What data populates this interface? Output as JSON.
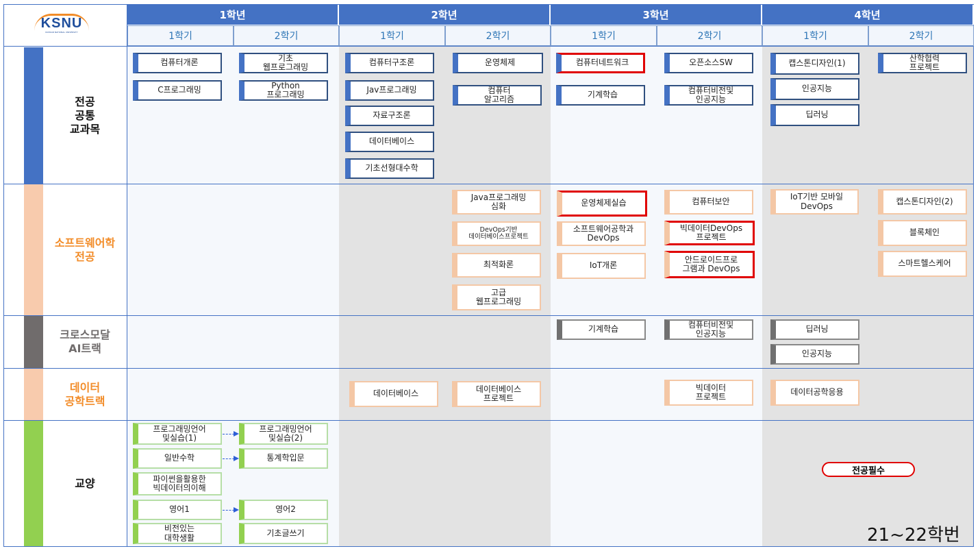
{
  "logo": {
    "text": "KSNU",
    "subtext": "KUNSAN NATIONAL UNIVERSITY"
  },
  "years": [
    "1학년",
    "2학년",
    "3학년",
    "4학년"
  ],
  "semesters": [
    "1학기",
    "2학기",
    "1학기",
    "2학기",
    "1학기",
    "2학기",
    "1학기",
    "2학기"
  ],
  "categories": {
    "major_common": "전공\n공통\n교과목",
    "software": "소프트웨어학\n전공",
    "crossmodal": "크로스모달\nAI트랙",
    "data": "데이터\n공학트랙",
    "liberal": "교양"
  },
  "courses": {
    "cs_intro": "컴퓨터개론",
    "c_prog": "C프로그래밍",
    "basic_web": "기초\n웹프로그래밍",
    "python_prog": "Python\n프로그래밍",
    "comp_struct": "컴퓨터구조론",
    "java_prog": "Jav프로그래밍",
    "data_struct": "자료구조론",
    "database": "데이터베이스",
    "linear_algebra": "기초선형대수학",
    "os": "운영체제",
    "algorithms": "컴퓨터\n알고리즘",
    "networks": "컴퓨터네트워크",
    "ml": "기계학습",
    "oss": "오픈소스SW",
    "cv_ai": "컴퓨터비전및\n인공지능",
    "capstone1": "캡스톤디자인(1)",
    "ai": "인공지능",
    "dl": "딥러닝",
    "industry_project": "산학협력\n프로젝트",
    "java_adv": "Java프로그래밍\n심화",
    "devops_db": "DevOps기반\n데이터베이스프로젝트",
    "optimization": "최적화론",
    "adv_web": "고급\n웹프로그래밍",
    "os_lab": "운영체제실습",
    "se_devops": "소프트웨어공학과\nDevOps",
    "iot_intro": "IoT개론",
    "security": "컴퓨터보안",
    "bigdata_devops": "빅데이터DevOps\n프로젝트",
    "android_devops": "안드로이드프로\n그램과 DevOps",
    "iot_mobile": "IoT기반 모바일\nDevOps",
    "capstone2": "캡스톤디자인(2)",
    "blockchain": "블록체인",
    "smart_health": "스마트헬스케어",
    "cm_ml": "기계학습",
    "cm_cv_ai": "컴퓨터비전및\n인공지능",
    "cm_dl": "딥러닝",
    "cm_ai": "인공지능",
    "d_database": "데이터베이스",
    "db_project": "데이터베이스\n프로젝트",
    "bigdata_project": "빅데이터\n프로젝트",
    "data_eng_app": "데이터공학응용",
    "prog_lang1": "프로그래밍언어\n및실습(1)",
    "prog_lang2": "프로그래밍언어\n및실습(2)",
    "gen_math": "일반수학",
    "stats_intro": "통계학입문",
    "python_bigdata": "파이썬을활용한\n빅데이터의이해",
    "english1": "영어1",
    "english2": "영어2",
    "college_life": "비전있는\n대학생활",
    "basic_writing": "기초글쓰기"
  },
  "legend": "전공필수",
  "footer": "21~22학번",
  "colors": {
    "header_blue": "#4472c4",
    "required_red": "#e00000",
    "software_orange": "#f4c7a5",
    "category_orange": "#f28c28",
    "crossmodal_gray": "#706c6c",
    "liberal_green": "#92d050"
  }
}
